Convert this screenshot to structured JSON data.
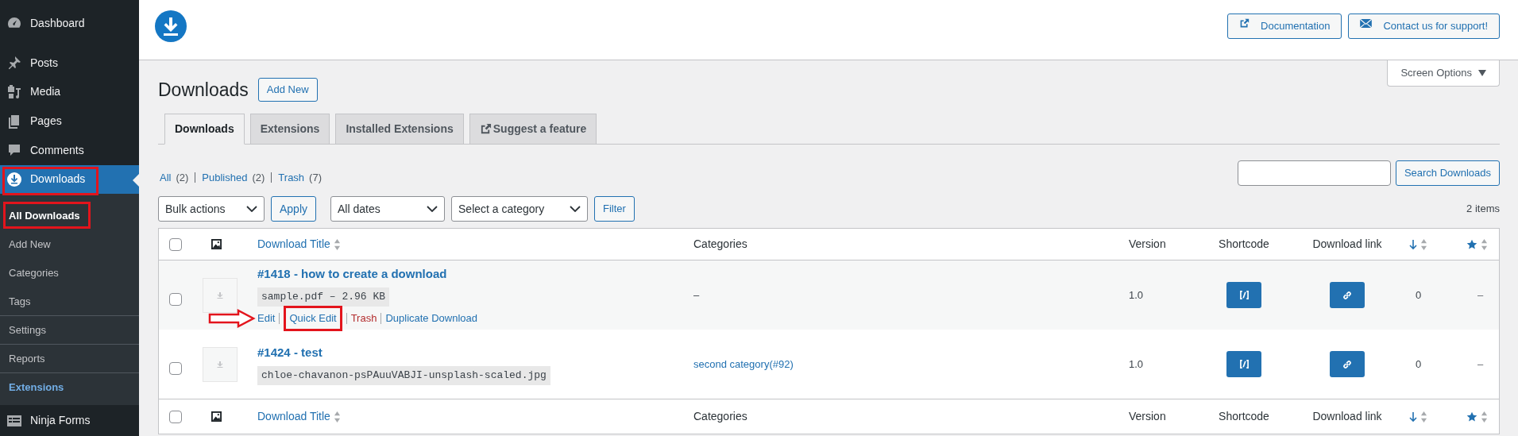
{
  "sidebar": {
    "items": [
      {
        "label": "Dashboard",
        "selected": false,
        "annotated": false
      },
      {
        "label": "Posts",
        "selected": false,
        "annotated": false
      },
      {
        "label": "Media",
        "selected": false,
        "annotated": false
      },
      {
        "label": "Pages",
        "selected": false,
        "annotated": false
      },
      {
        "label": "Comments",
        "selected": false,
        "annotated": false
      },
      {
        "label": "Downloads",
        "selected": true,
        "annotated": true,
        "children": [
          {
            "label": "All Downloads",
            "selected": true,
            "annotated": true,
            "emphasized": true
          },
          {
            "label": "Add New",
            "selected": false,
            "annotated": false,
            "emphasized": false
          },
          {
            "label": "Categories",
            "selected": false,
            "annotated": false,
            "emphasized": false
          },
          {
            "label": "Tags",
            "selected": false,
            "annotated": false,
            "emphasized": false
          },
          {
            "label": "Settings",
            "selected": false,
            "annotated": false,
            "emphasized": false
          },
          {
            "label": "Reports",
            "selected": false,
            "annotated": false,
            "emphasized": false
          },
          {
            "label": "Extensions",
            "selected": false,
            "annotated": false,
            "emphasized": true
          }
        ]
      },
      {
        "label": "Ninja Forms",
        "selected": false,
        "annotated": false
      }
    ]
  },
  "header": {
    "buttons": [
      {
        "label": "Documentation",
        "kind": "external"
      },
      {
        "label": "Contact us for support!",
        "kind": "mail"
      }
    ]
  },
  "screen_options": {
    "label": "Screen Options"
  },
  "page_title": "Downloads",
  "add_new": "Add New",
  "tabs": [
    {
      "label": "Downloads",
      "selected": true,
      "external": false
    },
    {
      "label": "Extensions",
      "selected": false,
      "external": false
    },
    {
      "label": "Installed Extensions",
      "selected": false,
      "external": false
    },
    {
      "label": "Suggest a feature",
      "selected": false,
      "external": true
    }
  ],
  "status_links": [
    {
      "label": "All",
      "count": "(2)"
    },
    {
      "label": "Published",
      "count": "(2)"
    },
    {
      "label": "Trash",
      "count": "(7)"
    }
  ],
  "search": {
    "button": "Search Downloads"
  },
  "filters": {
    "bulk_actions": "Bulk actions",
    "apply": "Apply",
    "dates": "All dates",
    "category": "Select a category",
    "filter": "Filter"
  },
  "item_count": "2 items",
  "table": {
    "columns": [
      {
        "kind": "checkbox",
        "checked": false
      },
      {
        "kind": "image"
      },
      {
        "kind": "text",
        "label": "Download Title",
        "sortable": true
      },
      {
        "kind": "text",
        "label": "Categories",
        "sortable": false
      },
      {
        "kind": "text",
        "label": "Version",
        "sortable": false
      },
      {
        "kind": "text",
        "label": "Shortcode",
        "sortable": false
      },
      {
        "kind": "text",
        "label": "Download link",
        "sortable": false
      },
      {
        "kind": "downloads",
        "sortable": true
      },
      {
        "kind": "rating",
        "sortable": true
      }
    ],
    "rows": [
      {
        "checked": false,
        "hovered": true,
        "title": "#1418 - how to create a download",
        "file": "sample.pdf – 2.96 KB",
        "actions": [
          {
            "label": "Edit",
            "kind": "link",
            "annotated": false
          },
          {
            "label": "Quick Edit",
            "kind": "link",
            "annotated": true
          },
          {
            "label": "Trash",
            "kind": "danger",
            "annotated": false
          },
          {
            "label": "Duplicate Download",
            "kind": "link",
            "annotated": false
          }
        ],
        "categories": {
          "text": "–",
          "link": false
        },
        "version": "1.0",
        "downloads": "0",
        "rating": "–"
      },
      {
        "checked": false,
        "hovered": false,
        "title": "#1424 - test",
        "file": "chloe-chavanon-psPAuuVABJI-unsplash-scaled.jpg",
        "categories": {
          "text": "second category(#92)",
          "link": true
        },
        "version": "1.0",
        "downloads": "0",
        "rating": "–"
      }
    ],
    "footer_columns": [
      {
        "kind": "checkbox",
        "checked": false
      },
      {
        "kind": "image"
      },
      {
        "kind": "text",
        "label": "Download Title",
        "sortable": true
      },
      {
        "kind": "text",
        "label": "Categories",
        "sortable": false
      },
      {
        "kind": "text",
        "label": "Version",
        "sortable": false
      },
      {
        "kind": "text",
        "label": "Shortcode",
        "sortable": false
      },
      {
        "kind": "text",
        "label": "Download link",
        "sortable": false
      },
      {
        "kind": "downloads",
        "sortable": true
      },
      {
        "kind": "rating",
        "sortable": true
      }
    ]
  }
}
